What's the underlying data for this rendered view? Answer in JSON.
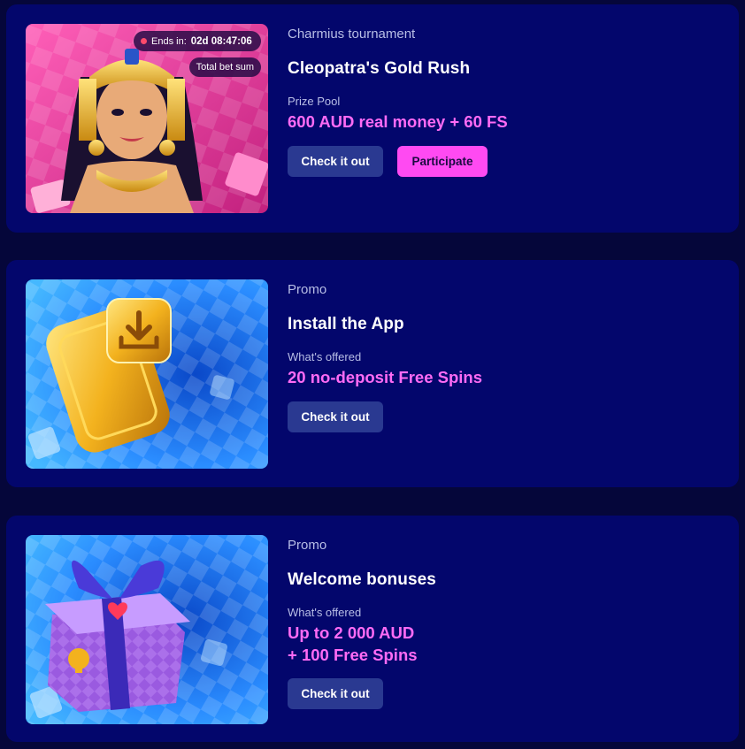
{
  "promos": [
    {
      "category": "Charmius tournament",
      "title": "Cleopatra's Gold Rush",
      "offer_label": "Prize Pool",
      "offer_lines": [
        "600 AUD real money + 60 FS"
      ],
      "buttons": {
        "check": "Check it out",
        "participate": "Participate"
      },
      "timer": {
        "label": "Ends in:",
        "value": "02d 08:47:06"
      },
      "badge": "Total bet sum",
      "image": "cleopatra-illustration"
    },
    {
      "category": "Promo",
      "title": "Install the App",
      "offer_label": "What's offered",
      "offer_lines": [
        "20 no-deposit Free Spins"
      ],
      "buttons": {
        "check": "Check it out"
      },
      "image": "gold-phone-download-illustration"
    },
    {
      "category": "Promo",
      "title": "Welcome bonuses",
      "offer_label": "What's offered",
      "offer_lines": [
        "Up to 2 000 AUD",
        "+ 100 Free Spins"
      ],
      "buttons": {
        "check": "Check it out"
      },
      "image": "gift-box-illustration"
    }
  ],
  "colors": {
    "page_bg": "#05063a",
    "card_bg": "#03066c",
    "accent_pink": "#ff4af2",
    "offer_text": "#ff6bf5",
    "secondary_button": "#2a3991"
  }
}
